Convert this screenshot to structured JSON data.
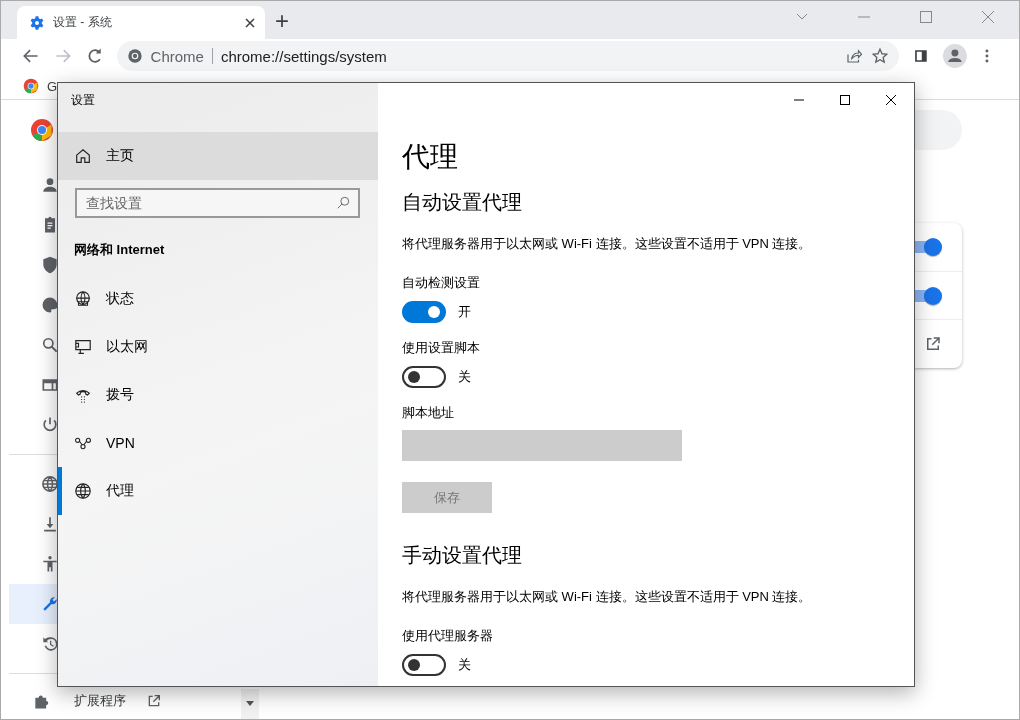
{
  "browser": {
    "tab": {
      "title": "设置 - 系统"
    },
    "new_tab": "+",
    "omnibox": {
      "chip": "Chrome",
      "url": "chrome://settings/system"
    },
    "bookmark": "G",
    "side_nav": [
      {
        "selected": false
      },
      {
        "selected": false
      },
      {
        "selected": false
      },
      {
        "selected": false
      },
      {
        "selected": false
      },
      {
        "selected": false
      },
      {
        "selected": false
      }
    ],
    "side_nav_2": [
      {
        "selected": false
      },
      {
        "selected": false
      },
      {
        "selected": false
      },
      {
        "selected": true
      },
      {
        "selected": false
      }
    ],
    "extensions": "扩展程序",
    "card_toggles": [
      {
        "on": true
      },
      {
        "on": true
      }
    ]
  },
  "dialog": {
    "title": "设置",
    "home": "主页",
    "search": {
      "placeholder": "查找设置"
    },
    "section": "网络和 Internet",
    "nav": [
      {
        "label": "状态",
        "selected": false
      },
      {
        "label": "以太网",
        "selected": false
      },
      {
        "label": "拨号",
        "selected": false
      },
      {
        "label": "VPN",
        "selected": false
      },
      {
        "label": "代理",
        "selected": true
      }
    ],
    "content": [
      {
        "kind": "title",
        "text": "代理"
      },
      {
        "kind": "heading",
        "text": "自动设置代理"
      },
      {
        "kind": "description",
        "text": "将代理服务器用于以太网或 Wi-Fi 连接。这些设置不适用于 VPN 连接。"
      },
      {
        "kind": "label",
        "text": "自动检测设置"
      },
      {
        "kind": "toggle",
        "on": true,
        "text": "开"
      },
      {
        "kind": "label",
        "text": "使用设置脚本"
      },
      {
        "kind": "toggle",
        "on": false,
        "text": "关"
      },
      {
        "kind": "label",
        "text": "脚本地址"
      },
      {
        "kind": "field",
        "disabled": true
      },
      {
        "kind": "button",
        "text": "保存",
        "disabled": true
      },
      {
        "kind": "heading",
        "text": "手动设置代理"
      },
      {
        "kind": "description",
        "text": "将代理服务器用于以太网或 Wi-Fi 连接。这些设置不适用于 VPN 连接。"
      },
      {
        "kind": "label",
        "text": "使用代理服务器"
      },
      {
        "kind": "toggle",
        "on": false,
        "text": "关"
      }
    ]
  }
}
